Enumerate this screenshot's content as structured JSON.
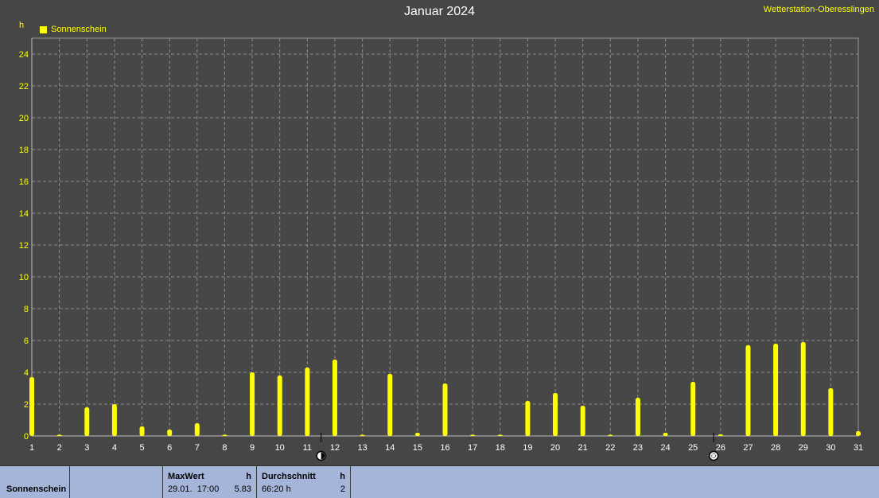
{
  "header": {
    "title": "Januar 2024",
    "station": "Wetterstation-Oberesslingen",
    "unit": "h",
    "legend_label": "Sonnenschein"
  },
  "colors": {
    "background": "#464646",
    "plot_background": "#474747",
    "series": "#ffff00",
    "grid": "#8c8c8c",
    "footer": "#a5b5d9"
  },
  "chart_data": {
    "type": "bar",
    "title": "Januar 2024",
    "xlabel": "",
    "ylabel": "h",
    "ylim": [
      0,
      25
    ],
    "yticks": [
      0,
      2,
      4,
      6,
      8,
      10,
      12,
      14,
      16,
      18,
      20,
      22,
      24
    ],
    "grid": true,
    "legend": "top-left",
    "categories": [
      "1",
      "2",
      "3",
      "4",
      "5",
      "6",
      "7",
      "8",
      "9",
      "10",
      "11",
      "12",
      "13",
      "14",
      "15",
      "16",
      "17",
      "18",
      "19",
      "20",
      "21",
      "22",
      "23",
      "24",
      "25",
      "26",
      "27",
      "28",
      "29",
      "30",
      "31"
    ],
    "series": [
      {
        "name": "Sonnenschein",
        "values": [
          3.7,
          0,
          1.8,
          2.0,
          0.6,
          0.4,
          0.8,
          0,
          4.0,
          3.8,
          4.3,
          4.8,
          0,
          3.9,
          0.2,
          3.3,
          0,
          0,
          2.2,
          2.7,
          1.9,
          0,
          2.4,
          0.2,
          3.4,
          0.1,
          5.7,
          5.8,
          5.9,
          3.0,
          0.3
        ]
      }
    ],
    "moon_phases": [
      {
        "day": 11.5,
        "phase": "new-moon"
      },
      {
        "day": 25.75,
        "phase": "full-moon"
      }
    ]
  },
  "footer": {
    "series_label": "Sonnenschein",
    "max": {
      "title": "MaxWert",
      "unit": "h",
      "when": "29.01.  17:00",
      "value": "5.83"
    },
    "avg": {
      "title": "Durchschnitt",
      "unit": "h",
      "sum": "66:20 h",
      "value": "2"
    }
  }
}
